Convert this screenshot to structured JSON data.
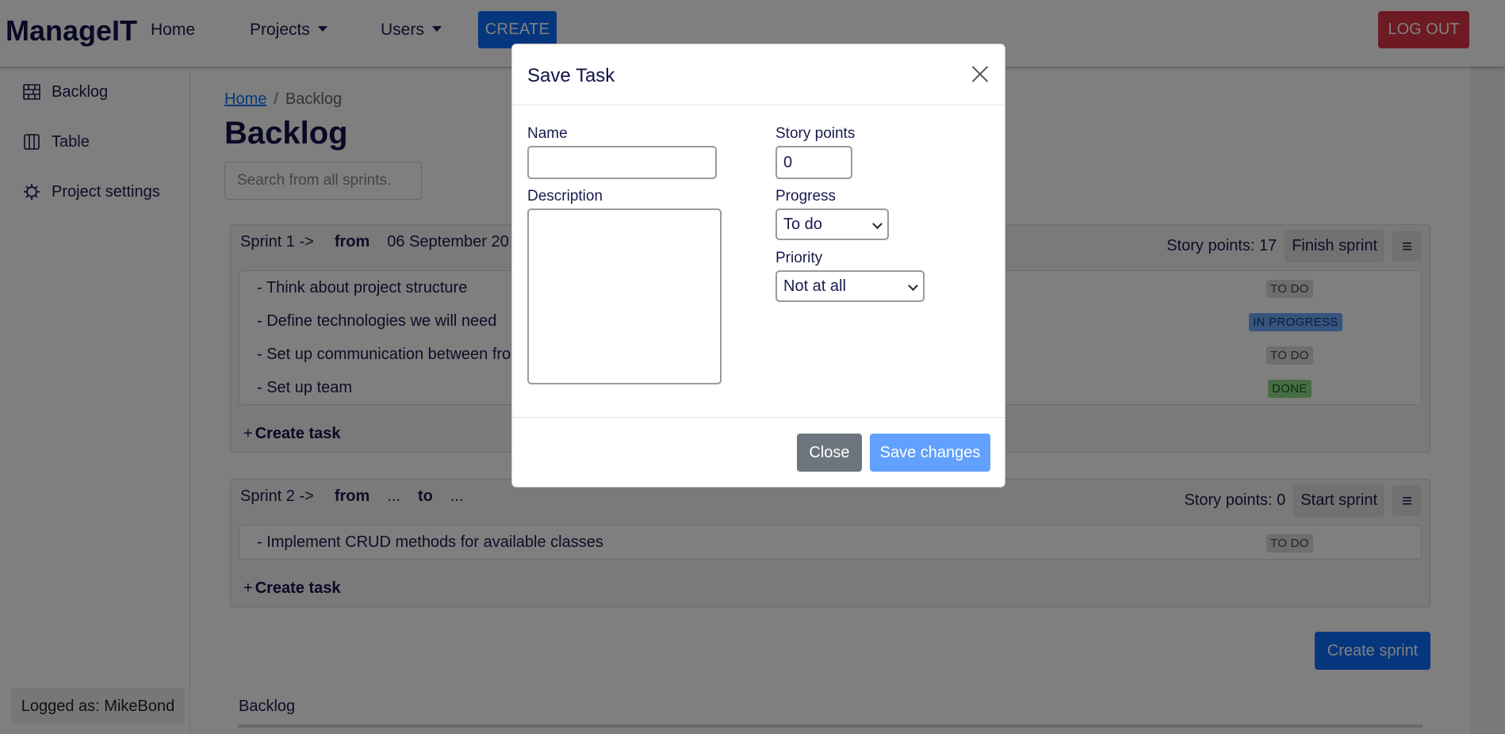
{
  "navbar": {
    "brand": "ManageIT",
    "home": "Home",
    "projects": "Projects",
    "users": "Users",
    "create": "CREATE",
    "logout": "LOG OUT"
  },
  "sidebar": {
    "items": [
      {
        "label": "Backlog",
        "icon": "backlog-icon"
      },
      {
        "label": "Table",
        "icon": "table-icon"
      },
      {
        "label": "Project settings",
        "icon": "gear-icon"
      }
    ],
    "logged_as": "Logged as: MikeBond"
  },
  "main": {
    "breadcrumb": {
      "home": "Home",
      "separator": "/",
      "current": "Backlog"
    },
    "title": "Backlog",
    "search_placeholder": "Search from all sprints.",
    "sprints": [
      {
        "name": "Sprint 1 ->",
        "from_label": "from",
        "from_value": "06 September 20",
        "story_points": "Story points: 17",
        "action": "Finish sprint",
        "tasks": [
          {
            "title": "- Think about project structure",
            "status": "TO DO"
          },
          {
            "title": "- Define technologies we will need",
            "status": "IN PROGRESS"
          },
          {
            "title": "- Set up communication between fro",
            "status": "TO DO"
          },
          {
            "title": "- Set up team",
            "status": "DONE"
          }
        ],
        "create_task": "Create task"
      },
      {
        "name": "Sprint 2 ->",
        "from_label": "from",
        "from_value": "...",
        "to_label": "to",
        "to_value": "...",
        "story_points": "Story points: 0",
        "action": "Start sprint",
        "tasks": [
          {
            "title": "- Implement CRUD methods for available classes",
            "status": "TO DO"
          }
        ],
        "create_task": "Create task"
      }
    ],
    "create_sprint": "Create sprint",
    "backlog_label": "Backlog"
  },
  "modal": {
    "title": "Save Task",
    "name_label": "Name",
    "name_value": "",
    "description_label": "Description",
    "description_value": "",
    "story_points_label": "Story points",
    "story_points_value": "0",
    "progress_label": "Progress",
    "progress_value": "To do",
    "priority_label": "Priority",
    "priority_value": "Not at all",
    "close": "Close",
    "save": "Save changes"
  },
  "colors": {
    "primary": "#0d6efd",
    "danger": "#dc3545",
    "secondary": "#6c757d",
    "text": "#1a1a4e"
  }
}
